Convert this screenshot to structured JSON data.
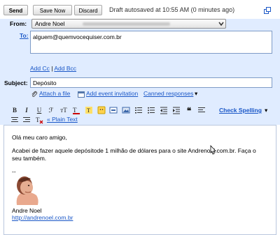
{
  "toolbar": {
    "send_label": "Send",
    "save_label": "Save Now",
    "discard_label": "Discard",
    "autosave_text": "Draft autosaved at 10:55 AM (0 minutes ago)"
  },
  "compose": {
    "from_label": "From:",
    "from_value": "Andre Noel",
    "to_label": "To:",
    "to_value": "alguem@quemvocequiser.com.br",
    "add_cc": "Add Cc",
    "cc_sep": "|",
    "add_bcc": "Add Bcc",
    "subject_label": "Subject:",
    "subject_value": "Depósito",
    "attach_label": "Attach a file",
    "event_label": "Add event invitation",
    "canned_label": "Canned responses",
    "canned_arrow": "▾"
  },
  "format": {
    "check_spelling": "Check Spelling",
    "spell_arrow": "▾",
    "plain_text": "« Plain Text"
  },
  "message": {
    "greeting": "Olá meu caro amigo,",
    "line1": "Acabei de fazer aquele depósitode 1 milhão de dólares para o site Andrenoel.com.br. Faça o",
    "line2": "seu também.",
    "sig_sep": "--",
    "sig_name": "Andre Noel",
    "sig_link": "http://andrenoel.com.br"
  },
  "colors": {
    "header_bg": "#e0ecff",
    "link": "#1a57c7"
  }
}
